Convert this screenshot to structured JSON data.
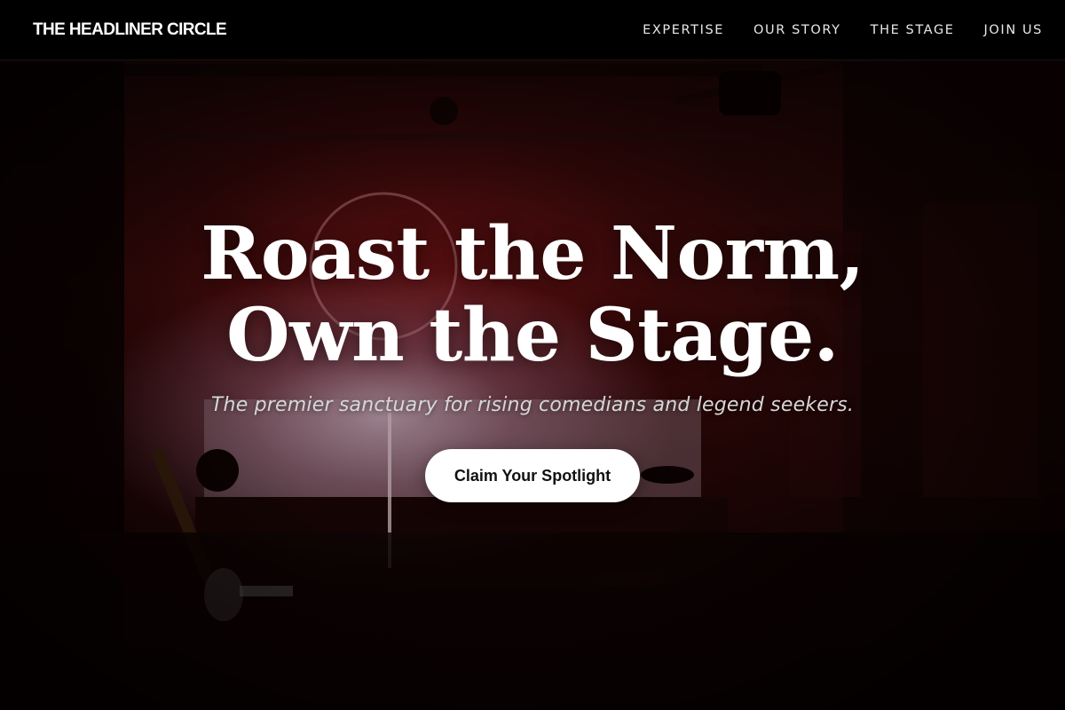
{
  "brand": {
    "name": "THE HEADLINER CIRCLE"
  },
  "nav": {
    "items": [
      {
        "label": "EXPERTISE"
      },
      {
        "label": "OUR STORY"
      },
      {
        "label": "THE STAGE"
      },
      {
        "label": "JOIN US"
      }
    ]
  },
  "hero": {
    "headline_line1": "Roast the Norm,",
    "headline_line2": "Own the Stage.",
    "subheadline": "The premier sanctuary for rising comedians and legend seekers.",
    "cta_label": "Claim Your Spotlight",
    "background_image": "comedy-club-stage-photo"
  },
  "colors": {
    "nav_bg": "#000000",
    "text_primary": "#ffffff",
    "accent_red": "#5a0f0f",
    "cta_bg": "#ffffff",
    "cta_text": "#111111"
  }
}
